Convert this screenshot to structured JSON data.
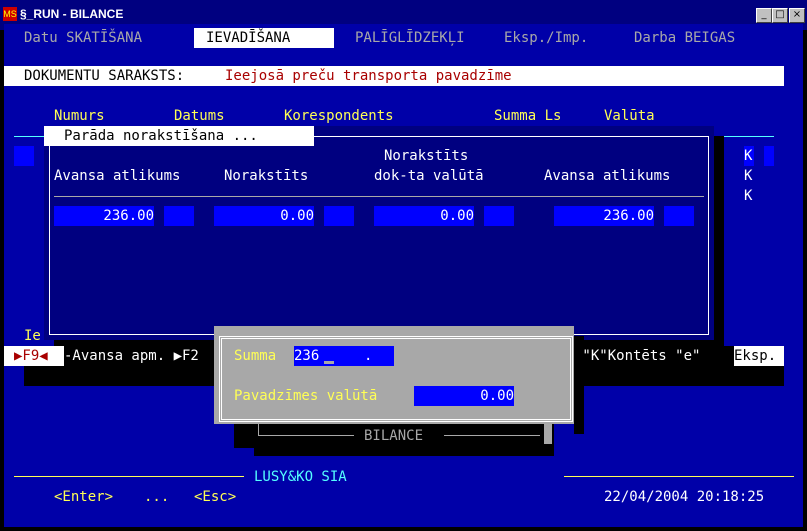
{
  "window": {
    "title": "§_RUN - BILANCE",
    "icon_text": "MS",
    "minimize": "_",
    "maximize": "□",
    "close": "×"
  },
  "menu": {
    "items": [
      "Datu SKATĪŠANA",
      "IEVADĪŠANA",
      "PALĪGLĪDZEKĻI",
      "Eksp./Imp.",
      "Darba BEIGAS"
    ],
    "active_index": 1
  },
  "doc_list": {
    "label": "DOKUMENTU SARAKSTS:",
    "name": "Ieejosā preču transporta pavadzīme",
    "columns": [
      "Numurs",
      "Datums",
      "Korespondents",
      "Summa Ls",
      "Valūta"
    ],
    "side_marks": [
      "K",
      "K",
      "K"
    ],
    "partial_bottom_left": "Ie"
  },
  "popup": {
    "title": "Parāda norakstīšana ...",
    "headers": {
      "col1": "Avansa atlikums",
      "col2": "Norakstīts",
      "col3_line1": "Norakstīts",
      "col3_line2": "dok-ta valūtā",
      "col4": "Avansa atlikums"
    },
    "values": {
      "col1": "236.00",
      "col2": "0.00",
      "col3": "0.00",
      "col4": "236.00"
    }
  },
  "status_line": {
    "f9": "▶F9◀",
    "left_text": "-Avansa apm. ▶F2",
    "right_text": ".\"K\"Kontēts \"e\"",
    "eksp": "Eksp."
  },
  "input_dialog": {
    "summa_label": "Summa",
    "summa_value": "236",
    "summa_tail": ".",
    "pav_label": "Pavadzīmes valūtā",
    "pav_value": "0.00"
  },
  "bilance_label": "BILANCE",
  "footer": {
    "company": "LUSY&KO SIA",
    "enter": "<Enter>",
    "dots": "...",
    "esc": "<Esc>",
    "datetime": "22/04/2004 20:18:25"
  }
}
